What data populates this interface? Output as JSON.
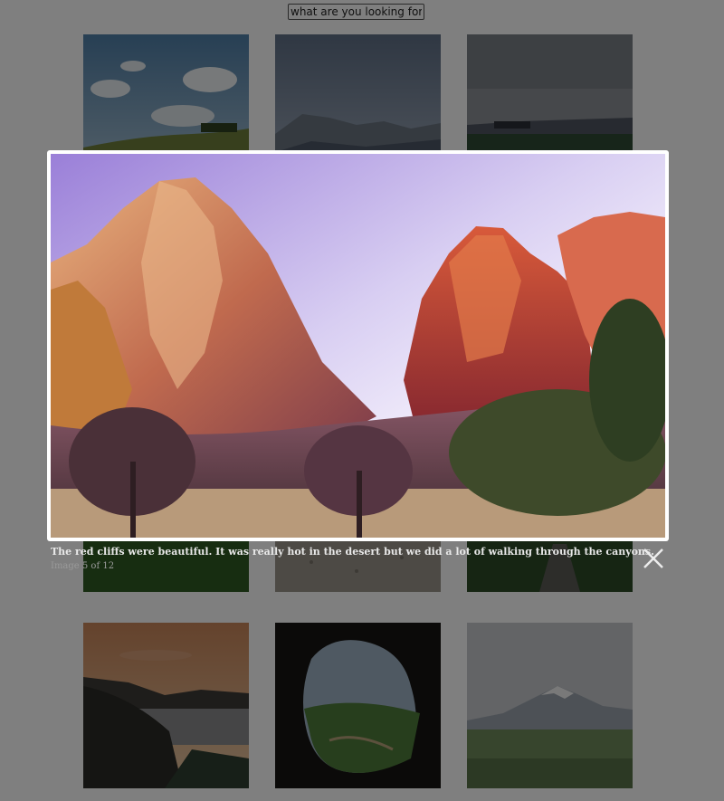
{
  "search": {
    "placeholder": "what are you looking for?"
  },
  "gallery": {
    "thumbnails": [
      {
        "scene": "sky-meadow"
      },
      {
        "scene": "misty-mountains"
      },
      {
        "scene": "overcast-field"
      },
      {
        "scene": "grass"
      },
      {
        "scene": "sand"
      },
      {
        "scene": "forest-path"
      },
      {
        "scene": "coast-sunset"
      },
      {
        "scene": "cave-valley"
      },
      {
        "scene": "snowy-peak-field"
      }
    ]
  },
  "lightbox": {
    "caption": "The red cliffs were beautiful. It was really hot in the desert but we did a lot of walking through the canyons.",
    "counter": "Image 5 of 12",
    "close_icon": "close-icon"
  },
  "colors": {
    "overlay": "rgba(0,0,0,0.5)",
    "caption_text": "#e8e8e8",
    "counter_text": "#9a9a9a"
  }
}
